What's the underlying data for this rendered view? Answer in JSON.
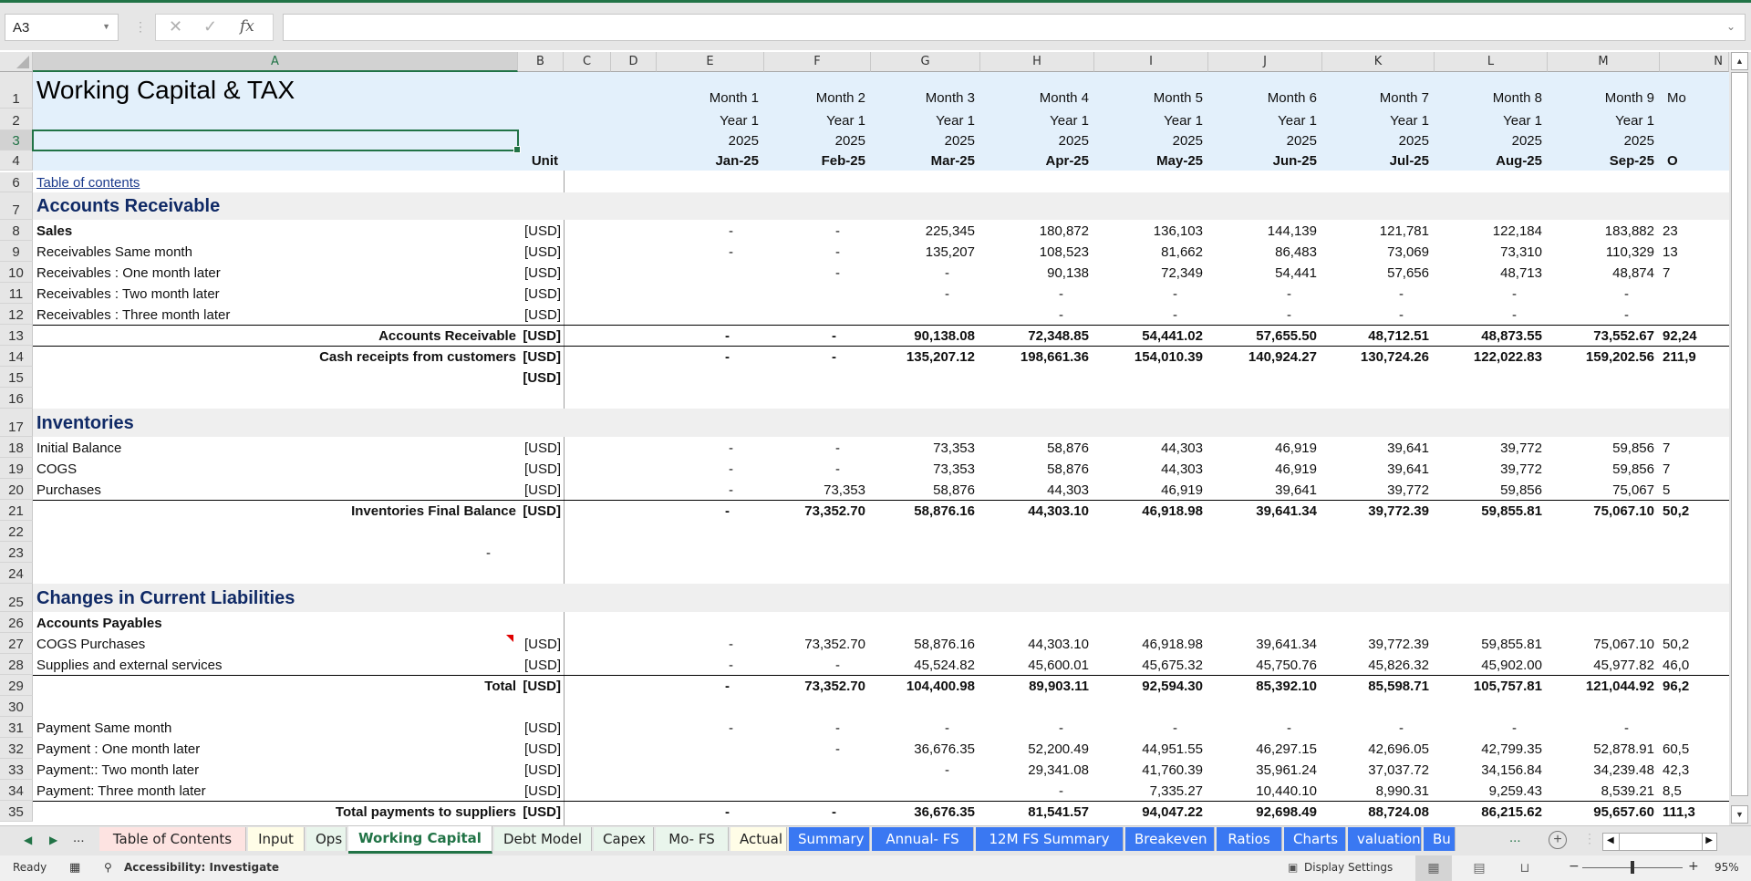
{
  "app": {
    "accent": "#217346"
  },
  "formula_bar": {
    "name_box": "A3",
    "cancel_icon": "✕",
    "enter_icon": "✓",
    "fx_label": "fx",
    "formula_value": ""
  },
  "columns": [
    "A",
    "B",
    "C",
    "D",
    "E",
    "F",
    "G",
    "H",
    "I",
    "J",
    "K",
    "L",
    "M",
    "N"
  ],
  "selected_column": "A",
  "selected_cell": "A3",
  "sheet": {
    "title": "Working Capital & TAX",
    "unit_header": "Unit",
    "months": [
      {
        "month": "Month 1",
        "year": "Year 1",
        "yyyy": "2025",
        "date": "Jan-25"
      },
      {
        "month": "Month 2",
        "year": "Year 1",
        "yyyy": "2025",
        "date": "Feb-25"
      },
      {
        "month": "Month 3",
        "year": "Year 1",
        "yyyy": "2025",
        "date": "Mar-25"
      },
      {
        "month": "Month 4",
        "year": "Year 1",
        "yyyy": "2025",
        "date": "Apr-25"
      },
      {
        "month": "Month 5",
        "year": "Year 1",
        "yyyy": "2025",
        "date": "May-25"
      },
      {
        "month": "Month 6",
        "year": "Year 1",
        "yyyy": "2025",
        "date": "Jun-25"
      },
      {
        "month": "Month 7",
        "year": "Year 1",
        "yyyy": "2025",
        "date": "Jul-25"
      },
      {
        "month": "Month 8",
        "year": "Year 1",
        "yyyy": "2025",
        "date": "Aug-25"
      },
      {
        "month": "Month 9",
        "year": "Year 1",
        "yyyy": "2025",
        "date": "Sep-25"
      },
      {
        "month": "Mo",
        "year": "",
        "yyyy": "",
        "date": "O"
      }
    ],
    "toc_link": "Table of contents",
    "rows": [
      {
        "num": "8",
        "label": "Sales",
        "unit": "[USD]",
        "style": "bold-label",
        "values": [
          "-",
          "-",
          "225,345",
          "180,872",
          "136,103",
          "144,139",
          "121,781",
          "122,184",
          "183,882",
          "23"
        ]
      },
      {
        "num": "9",
        "label": "Receivables Same month",
        "unit": "[USD]",
        "style": "normal",
        "values": [
          "-",
          "-",
          "135,207",
          "108,523",
          "81,662",
          "86,483",
          "73,069",
          "73,310",
          "110,329",
          "13"
        ]
      },
      {
        "num": "10",
        "label": "Receivables : One month later",
        "unit": "[USD]",
        "style": "normal",
        "values": [
          "",
          "-",
          "-",
          "90,138",
          "72,349",
          "54,441",
          "57,656",
          "48,713",
          "48,874",
          "7"
        ]
      },
      {
        "num": "11",
        "label": "Receivables : Two month later",
        "unit": "[USD]",
        "style": "normal",
        "values": [
          "",
          "",
          "-",
          "-",
          "-",
          "-",
          "-",
          "-",
          "-",
          ""
        ]
      },
      {
        "num": "12",
        "label": "Receivables : Three month later",
        "unit": "[USD]",
        "style": "normal",
        "values": [
          "",
          "",
          "",
          "-",
          "-",
          "-",
          "-",
          "-",
          "-",
          ""
        ]
      },
      {
        "num": "13",
        "label": "Accounts Receivable",
        "unit": "[USD]",
        "style": "total",
        "values": [
          "-",
          "-",
          "90,138.08",
          "72,348.85",
          "54,441.02",
          "57,655.50",
          "48,712.51",
          "48,873.55",
          "73,552.67",
          "92,24"
        ]
      },
      {
        "num": "14",
        "label": "Cash receipts from customers",
        "unit": "[USD]",
        "style": "total",
        "values": [
          "-",
          "-",
          "135,207.12",
          "198,661.36",
          "154,010.39",
          "140,924.27",
          "130,724.26",
          "122,022.83",
          "159,202.56",
          "211,9"
        ]
      },
      {
        "num": "15",
        "label": "",
        "unit": "[USD]",
        "style": "bold-unit",
        "values": [
          "",
          "",
          "",
          "",
          "",
          "",
          "",
          "",
          "",
          ""
        ]
      },
      {
        "num": "16",
        "label": "",
        "unit": "",
        "style": "normal",
        "values": [
          "",
          "",
          "",
          "",
          "",
          "",
          "",
          "",
          "",
          ""
        ]
      },
      {
        "num": "17",
        "label": "Inventories",
        "unit": "",
        "style": "section",
        "values": [
          "",
          "",
          "",
          "",
          "",
          "",
          "",
          "",
          "",
          ""
        ]
      },
      {
        "num": "18",
        "label": "Initial Balance",
        "unit": "[USD]",
        "style": "normal",
        "values": [
          "-",
          "-",
          "73,353",
          "58,876",
          "44,303",
          "46,919",
          "39,641",
          "39,772",
          "59,856",
          "7"
        ]
      },
      {
        "num": "19",
        "label": "COGS",
        "unit": "[USD]",
        "style": "normal",
        "values": [
          "-",
          "-",
          "73,353",
          "58,876",
          "44,303",
          "46,919",
          "39,641",
          "39,772",
          "59,856",
          "7"
        ]
      },
      {
        "num": "20",
        "label": "Purchases",
        "unit": "[USD]",
        "style": "normal",
        "values": [
          "-",
          "73,353",
          "58,876",
          "44,303",
          "46,919",
          "39,641",
          "39,772",
          "59,856",
          "75,067",
          "5"
        ]
      },
      {
        "num": "21",
        "label": "Inventories Final Balance",
        "unit": "[USD]",
        "style": "total",
        "values": [
          "-",
          "73,352.70",
          "58,876.16",
          "44,303.10",
          "46,918.98",
          "39,641.34",
          "39,772.39",
          "59,855.81",
          "75,067.10",
          "50,2"
        ]
      },
      {
        "num": "22",
        "label": "",
        "unit": "",
        "style": "normal",
        "values": [
          "",
          "",
          "",
          "",
          "",
          "",
          "",
          "",
          "",
          ""
        ]
      },
      {
        "num": "23",
        "label": "-",
        "unit": "",
        "style": "dash-a",
        "values": [
          "",
          "",
          "",
          "",
          "",
          "",
          "",
          "",
          "",
          ""
        ]
      },
      {
        "num": "24",
        "label": "",
        "unit": "",
        "style": "normal",
        "values": [
          "",
          "",
          "",
          "",
          "",
          "",
          "",
          "",
          "",
          ""
        ]
      },
      {
        "num": "25",
        "label": "Changes in Current Liabilities",
        "unit": "",
        "style": "section",
        "values": [
          "",
          "",
          "",
          "",
          "",
          "",
          "",
          "",
          "",
          ""
        ]
      },
      {
        "num": "26",
        "label": "Accounts Payables",
        "unit": "",
        "style": "bold-label",
        "values": [
          "",
          "",
          "",
          "",
          "",
          "",
          "",
          "",
          "",
          ""
        ]
      },
      {
        "num": "27",
        "label": "COGS Purchases",
        "unit": "[USD]",
        "style": "normal",
        "comment": true,
        "values": [
          "-",
          "73,352.70",
          "58,876.16",
          "44,303.10",
          "46,918.98",
          "39,641.34",
          "39,772.39",
          "59,855.81",
          "75,067.10",
          "50,2"
        ]
      },
      {
        "num": "28",
        "label": "Supplies and external services",
        "unit": "[USD]",
        "style": "normal",
        "values": [
          "-",
          "-",
          "45,524.82",
          "45,600.01",
          "45,675.32",
          "45,750.76",
          "45,826.32",
          "45,902.00",
          "45,977.82",
          "46,0"
        ]
      },
      {
        "num": "29",
        "label": "Total",
        "unit": "[USD]",
        "style": "total",
        "values": [
          "-",
          "73,352.70",
          "104,400.98",
          "89,903.11",
          "92,594.30",
          "85,392.10",
          "85,598.71",
          "105,757.81",
          "121,044.92",
          "96,2"
        ]
      },
      {
        "num": "30",
        "label": "",
        "unit": "",
        "style": "normal",
        "values": [
          "",
          "",
          "",
          "",
          "",
          "",
          "",
          "",
          "",
          ""
        ]
      },
      {
        "num": "31",
        "label": "Payment Same month",
        "unit": "[USD]",
        "style": "normal",
        "values": [
          "-",
          "-",
          "-",
          "-",
          "-",
          "-",
          "-",
          "-",
          "-",
          ""
        ]
      },
      {
        "num": "32",
        "label": "Payment : One month later",
        "unit": "[USD]",
        "style": "normal",
        "values": [
          "",
          "-",
          "36,676.35",
          "52,200.49",
          "44,951.55",
          "46,297.15",
          "42,696.05",
          "42,799.35",
          "52,878.91",
          "60,5"
        ]
      },
      {
        "num": "33",
        "label": "Payment:: Two month later",
        "unit": "[USD]",
        "style": "normal",
        "values": [
          "",
          "",
          "-",
          "29,341.08",
          "41,760.39",
          "35,961.24",
          "37,037.72",
          "34,156.84",
          "34,239.48",
          "42,3"
        ]
      },
      {
        "num": "34",
        "label": "Payment: Three month later",
        "unit": "[USD]",
        "style": "normal",
        "values": [
          "",
          "",
          "",
          "-",
          "7,335.27",
          "10,440.10",
          "8,990.31",
          "9,259.43",
          "8,539.21",
          "8,5"
        ]
      },
      {
        "num": "35",
        "label": "Total payments to suppliers",
        "unit": "[USD]",
        "style": "total",
        "values": [
          "-",
          "-",
          "36,676.35",
          "81,541.57",
          "94,047.22",
          "92,698.49",
          "88,724.08",
          "86,215.62",
          "95,657.60",
          "111,3"
        ]
      }
    ],
    "section_ar": "Accounts Receivable"
  },
  "tabs": [
    {
      "label": "Table of Contents",
      "color": "#fde3e1",
      "text": "#222"
    },
    {
      "label": "Input",
      "color": "#fffde7",
      "text": "#222"
    },
    {
      "label": "Ops",
      "color": "#e9f5ec",
      "text": "#222"
    },
    {
      "label": "Working Capital",
      "color": "#ffffff",
      "text": "#217346",
      "active": true
    },
    {
      "label": "Debt Model",
      "color": "#e9f5ec",
      "text": "#222"
    },
    {
      "label": "Capex",
      "color": "#e9f5ec",
      "text": "#222"
    },
    {
      "label": "Mo- FS",
      "color": "#e9f5ec",
      "text": "#222"
    },
    {
      "label": "Actual",
      "color": "#fffde7",
      "text": "#222"
    },
    {
      "label": "Summary",
      "color": "#3a78f2",
      "text": "#fff"
    },
    {
      "label": "Annual- FS",
      "color": "#3a78f2",
      "text": "#fff"
    },
    {
      "label": "12M FS Summary",
      "color": "#3a78f2",
      "text": "#fff"
    },
    {
      "label": "Breakeven",
      "color": "#3a78f2",
      "text": "#fff"
    },
    {
      "label": "Ratios",
      "color": "#3a78f2",
      "text": "#fff"
    },
    {
      "label": "Charts",
      "color": "#3a78f2",
      "text": "#fff"
    },
    {
      "label": "valuation",
      "color": "#3a78f2",
      "text": "#fff"
    },
    {
      "label": "Bu",
      "color": "#3a78f2",
      "text": "#fff"
    }
  ],
  "tab_nav": {
    "prev": "◀",
    "next": "▶",
    "more": "...",
    "more_right": "...",
    "add": "+"
  },
  "status": {
    "ready": "Ready",
    "accessibility": "Accessibility: Investigate",
    "display_settings": "Display Settings",
    "zoom_minus": "−",
    "zoom_plus": "+",
    "zoom_level": "95%",
    "zoom_fraction": 0.5
  }
}
